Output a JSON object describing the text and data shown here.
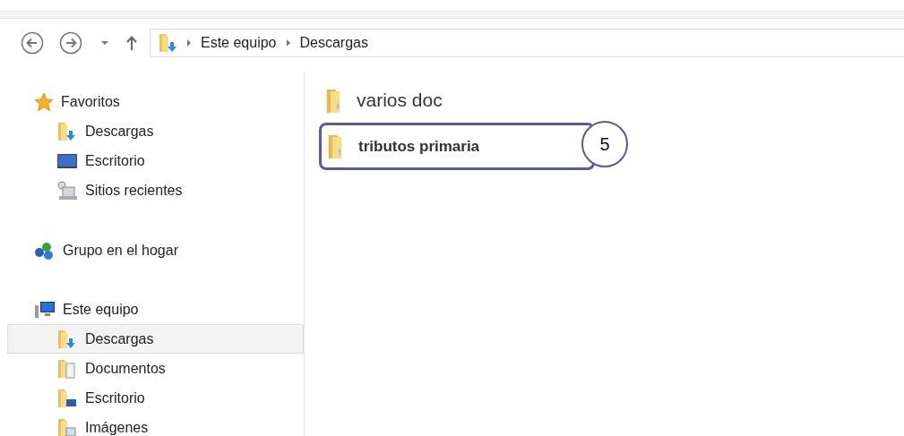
{
  "address_bar": {
    "breadcrumbs": [
      "Este equipo",
      "Descargas"
    ]
  },
  "sidebar": {
    "groups": [
      {
        "label": "Favoritos",
        "items": [
          {
            "label": "Descargas",
            "selected": false
          },
          {
            "label": "Escritorio",
            "selected": false
          },
          {
            "label": "Sitios recientes",
            "selected": false
          }
        ]
      },
      {
        "label": "Grupo en el hogar"
      },
      {
        "label": "Este equipo",
        "items": [
          {
            "label": "Descargas",
            "selected": true
          },
          {
            "label": "Documentos",
            "selected": false
          },
          {
            "label": "Escritorio",
            "selected": false
          },
          {
            "label": "Imágenes",
            "selected": false
          }
        ]
      }
    ]
  },
  "files": [
    {
      "name": "varios doc",
      "bold": false
    },
    {
      "name": "tributos primaria",
      "bold": true,
      "callout": "5"
    }
  ]
}
